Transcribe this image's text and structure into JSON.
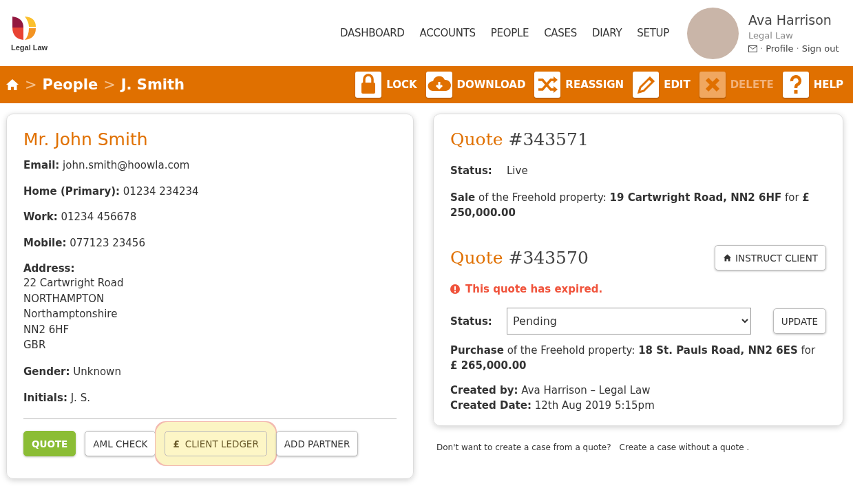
{
  "brand": {
    "name": "Legal Law"
  },
  "nav": [
    "DASHBOARD",
    "ACCOUNTS",
    "PEOPLE",
    "CASES",
    "DIARY",
    "SETUP"
  ],
  "user": {
    "name": "Ava Harrison",
    "company": "Legal Law",
    "links": [
      "Profile",
      "Sign out"
    ],
    "separator": "·"
  },
  "breadcrumb": {
    "separator": ">",
    "items": [
      "People",
      "J. Smith"
    ]
  },
  "actions": [
    {
      "kind": "lock",
      "label": "LOCK",
      "disabled": false
    },
    {
      "kind": "download",
      "label": "DOWNLOAD",
      "disabled": false
    },
    {
      "kind": "reassign",
      "label": "REASSIGN",
      "disabled": false
    },
    {
      "kind": "edit",
      "label": "EDIT",
      "disabled": false
    },
    {
      "kind": "delete",
      "label": "DELETE",
      "disabled": true
    },
    {
      "kind": "help",
      "label": "HELP",
      "disabled": false
    }
  ],
  "person": {
    "name": "Mr. John Smith",
    "fields": [
      {
        "kind": "inline",
        "label": "Email:",
        "value": "john.smith@hoowla.com"
      },
      {
        "kind": "inline",
        "label": "Home (Primary):",
        "value": "01234 234234"
      },
      {
        "kind": "inline",
        "label": "Work:",
        "value": "01234 456678"
      },
      {
        "kind": "inline",
        "label": "Mobile:",
        "value": "077123 23456"
      },
      {
        "kind": "block",
        "label": "Address:",
        "lines": [
          "22 Cartwright Road",
          "NORTHAMPTON",
          "Northamptonshire",
          "NN2 6HF",
          "GBR"
        ]
      },
      {
        "kind": "inline",
        "label": "Gender:",
        "value": "Unknown"
      },
      {
        "kind": "inline",
        "label": "Initials:",
        "value": "J. S."
      }
    ],
    "buttons": [
      {
        "kind": "primary",
        "label": "QUOTE",
        "highlighted": false
      },
      {
        "kind": "default",
        "label": "AML CHECK",
        "highlighted": false
      },
      {
        "kind": "default",
        "symbol": "£",
        "label": "CLIENT LEDGER",
        "highlighted": true
      },
      {
        "kind": "default",
        "label": "ADD PARTNER",
        "highlighted": false
      }
    ]
  },
  "quotes": [
    {
      "word": "Quote",
      "number": "#343571",
      "status_label": "Status:",
      "status": "Live",
      "description": "**Sale** of the Freehold property: **19 Cartwright Road, NN2 6HF** for **£ 250,000.00**"
    },
    {
      "word": "Quote",
      "number": "#343570",
      "button": "INSTRUCT CLIENT",
      "alert": "This quote has expired.",
      "status_label": "Status:",
      "status_select": "Pending",
      "update": "UPDATE",
      "description": "**Purchase** of the Freehold property: **18 St. Pauls Road, NN2 6ES** for **£ 265,000.00**",
      "created": [
        {
          "label": "Created by:",
          "value": "Ava Harrison – Legal Law"
        },
        {
          "label": "Created Date:",
          "value": "12th Aug 2019 5:15pm"
        }
      ]
    }
  ],
  "footer": {
    "text": "Don't want to create a case from a quote?",
    "link": "Create a case without a quote ."
  }
}
